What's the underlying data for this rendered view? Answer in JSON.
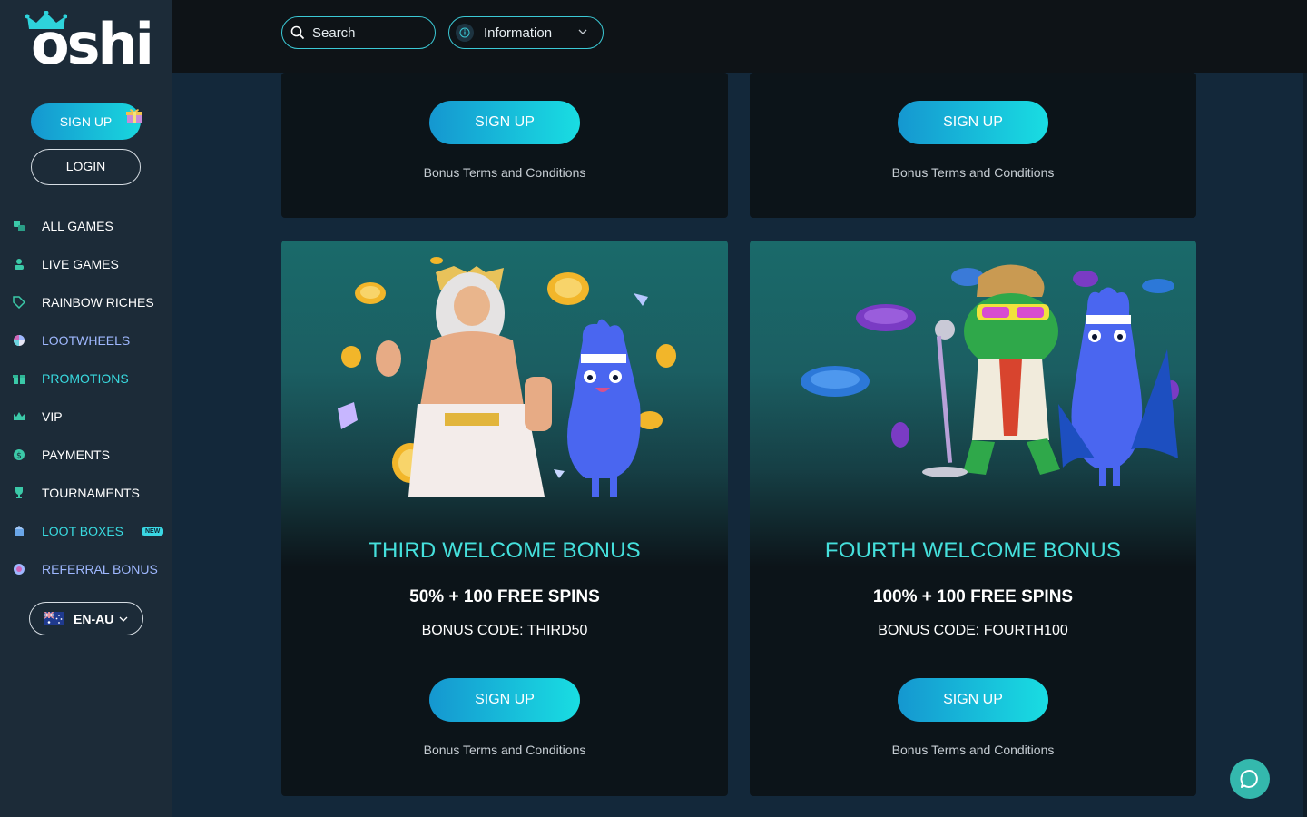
{
  "sidebar": {
    "logo_text": "oshi",
    "signup_label": "SIGN UP",
    "login_label": "LOGIN",
    "nav": [
      {
        "label": "ALL GAMES",
        "icon": "dice-icon",
        "style": "white"
      },
      {
        "label": "LIVE GAMES",
        "icon": "dealer-icon",
        "style": "white"
      },
      {
        "label": "RAINBOW RICHES",
        "icon": "tag-icon",
        "style": "white"
      },
      {
        "label": "LOOTWHEELS",
        "icon": "wheel-icon",
        "style": "lav"
      },
      {
        "label": "PROMOTIONS",
        "icon": "gift-icon",
        "style": "teal"
      },
      {
        "label": "VIP",
        "icon": "crown-icon",
        "style": "white"
      },
      {
        "label": "PAYMENTS",
        "icon": "coin-icon",
        "style": "white"
      },
      {
        "label": "TOURNAMENTS",
        "icon": "trophy-icon",
        "style": "white"
      },
      {
        "label": "LOOT BOXES",
        "icon": "lootbox-icon",
        "style": "teal",
        "badge": "NEW"
      },
      {
        "label": "REFERRAL BONUS",
        "icon": "referral-icon",
        "style": "lav"
      }
    ],
    "language": "EN-AU"
  },
  "topbar": {
    "search_placeholder": "Search",
    "info_label": "Information"
  },
  "cards_top": [
    {
      "cta": "SIGN UP",
      "terms": "Bonus Terms and Conditions"
    },
    {
      "cta": "SIGN UP",
      "terms": "Bonus Terms and Conditions"
    }
  ],
  "cards": [
    {
      "title": "THIRD WELCOME BONUS",
      "offer": "50% + 100 FREE SPINS",
      "code": "BONUS CODE: THIRD50",
      "cta": "SIGN UP",
      "terms": "Bonus Terms and Conditions"
    },
    {
      "title": "FOURTH WELCOME BONUS",
      "offer": "100% + 100 FREE SPINS",
      "code": "BONUS CODE: FOURTH100",
      "cta": "SIGN UP",
      "terms": "Bonus Terms and Conditions"
    }
  ],
  "colors": {
    "accent_teal": "#39dbe0",
    "accent_lavender": "#9fb8ff",
    "button_gradient_start": "#1597d0",
    "button_gradient_end": "#19dde2",
    "title_teal": "#45e0dc",
    "chat_button": "#34b8ad"
  }
}
